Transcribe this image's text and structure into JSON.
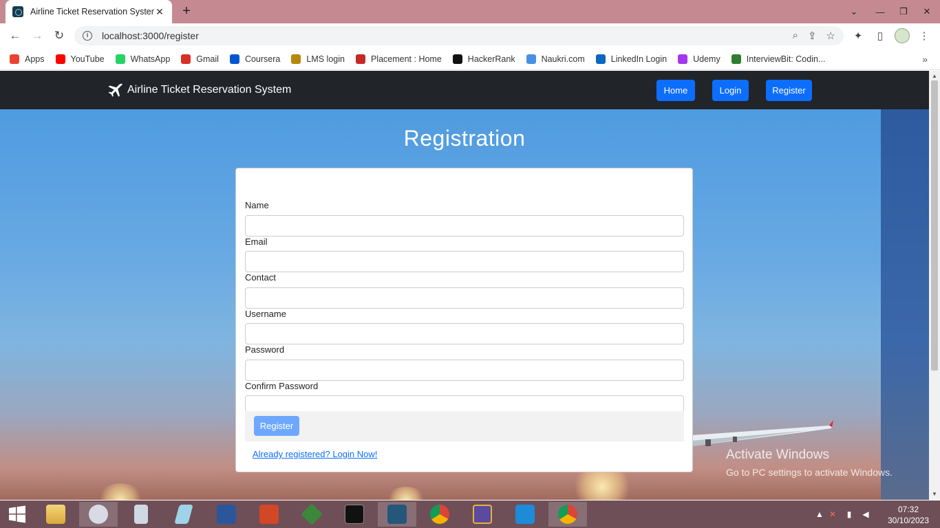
{
  "browser": {
    "tab_title": "Airline Ticket Reservation System",
    "url": "localhost:3000/register",
    "bookmarks": [
      {
        "label": "Apps",
        "color": "#ea4335"
      },
      {
        "label": "YouTube",
        "color": "#ff0000"
      },
      {
        "label": "WhatsApp",
        "color": "#25d366"
      },
      {
        "label": "Gmail",
        "color": "#d93025"
      },
      {
        "label": "Coursera",
        "color": "#0056d2"
      },
      {
        "label": "LMS login",
        "color": "#b8860b"
      },
      {
        "label": "Placement : Home",
        "color": "#c62828"
      },
      {
        "label": "HackerRank",
        "color": "#111111"
      },
      {
        "label": "Naukri.com",
        "color": "#4a90e2"
      },
      {
        "label": "LinkedIn Login",
        "color": "#0a66c2"
      },
      {
        "label": "Udemy",
        "color": "#a435f0"
      },
      {
        "label": "InterviewBit: Codin...",
        "color": "#2e7d32"
      }
    ]
  },
  "navbar": {
    "brand": "Airline Ticket Reservation System",
    "links": [
      "Home",
      "Login",
      "Register"
    ]
  },
  "form": {
    "title": "Registration",
    "fields": [
      {
        "label": "Name",
        "value": ""
      },
      {
        "label": "Email",
        "value": ""
      },
      {
        "label": "Contact",
        "value": ""
      },
      {
        "label": "Username",
        "value": ""
      },
      {
        "label": "Password",
        "value": ""
      },
      {
        "label": "Confirm Password",
        "value": ""
      }
    ],
    "submit_label": "Register",
    "login_link": "Already registered? Login Now!"
  },
  "watermark": {
    "line1": "Activate Windows",
    "line2": "Go to PC settings to activate Windows."
  },
  "taskbar": {
    "time": "07:32",
    "date": "30/10/2023"
  },
  "colors": {
    "navbar_bg": "#212529",
    "primary": "#0d6efd",
    "tabstrip": "#c58a91",
    "taskbar": "#6e4f57"
  }
}
